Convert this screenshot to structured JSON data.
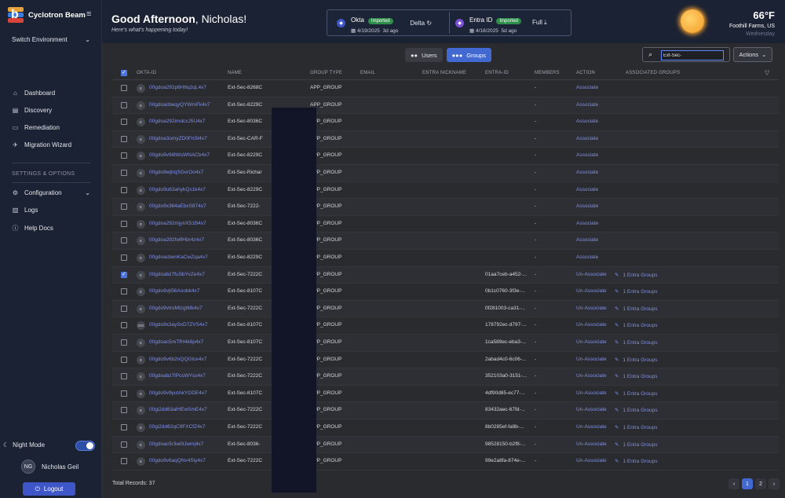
{
  "app": {
    "name": "Cyclotron Beam",
    "collapse_icon": "≡"
  },
  "sidebar": {
    "switch_env": "Switch Environment",
    "nav": [
      {
        "label": "Dashboard",
        "icon": "home-icon",
        "glyph": "⌂"
      },
      {
        "label": "Discovery",
        "icon": "document-icon",
        "glyph": "▤"
      },
      {
        "label": "Remediation",
        "icon": "monitor-icon",
        "glyph": "▭"
      },
      {
        "label": "Migration Wizard",
        "icon": "rocket-icon",
        "glyph": "✈"
      }
    ],
    "section": "SETTINGS & OPTIONS",
    "settings": [
      {
        "label": "Configuration",
        "icon": "gear-icon",
        "glyph": "⚙"
      },
      {
        "label": "Logs",
        "icon": "logs-icon",
        "glyph": "▥"
      },
      {
        "label": "Help Docs",
        "icon": "help-icon",
        "glyph": "ⓘ"
      }
    ],
    "night_mode": "Night Mode",
    "user": {
      "initials": "NG",
      "name": "Nicholas Geil"
    },
    "logout": "Logout"
  },
  "header": {
    "greeting_bold": "Good Afternoon",
    "greeting_rest": ", Nicholas!",
    "subtitle": "Here's what's happening today!",
    "sync": [
      {
        "name": "Okta",
        "badge": "Imported",
        "date": "4/19/2025",
        "ago": "3d ago",
        "mode": "Delta",
        "mode_icon": "↻"
      },
      {
        "name": "Entra ID",
        "badge": "Imported",
        "date": "4/18/2025",
        "ago": "5d ago",
        "mode": "Full",
        "mode_icon": "⤓"
      }
    ],
    "weather": {
      "temp": "66°F",
      "location": "Foothill Farms, US",
      "day": "Wednesday"
    }
  },
  "toolbar": {
    "tabs": [
      {
        "label": "Users",
        "icon": "users-icon",
        "glyph": "👥"
      },
      {
        "label": "Groups",
        "icon": "groups-icon",
        "glyph": "👥"
      }
    ],
    "search_value": "Ext-Sec-",
    "actions": "Actions"
  },
  "table": {
    "columns": [
      "OKTA-ID",
      "NAME",
      "GROUP TYPE",
      "EMAIL",
      "ENTRA NICKNAME",
      "ENTRA-ID",
      "MEMBERS",
      "ACTION",
      "ASSOCIATED GROUPS"
    ],
    "rows": [
      {
        "checked": false,
        "type": "E",
        "okta_id": "00gdoa292p6H6q2qL4x7",
        "name": "Ext-Sec-8268C",
        "group_type": "APP_GROUP",
        "entra_id": "",
        "members": "-",
        "action": "Associate",
        "assoc": ""
      },
      {
        "checked": false,
        "type": "E",
        "okta_id": "00gdoacbeqyQYWmFk4x7",
        "name": "Ext-Sec-8229C",
        "group_type": "APP_GROUP",
        "entra_id": "",
        "members": "-",
        "action": "Associate",
        "assoc": ""
      },
      {
        "checked": false,
        "type": "E",
        "okta_id": "00gdoa292imdcxJ5U4x7",
        "name": "Ext-Sec-8036C",
        "group_type": "APP_GROUP",
        "entra_id": "",
        "members": "-",
        "action": "Associate",
        "assoc": ""
      },
      {
        "checked": false,
        "type": "E",
        "okta_id": "00gdoa3omyZD0FnSl4x7",
        "name": "Ext-Sec-CAR-F",
        "group_type": "APP_GROUP",
        "entra_id": "",
        "members": "-",
        "action": "Associate",
        "assoc": ""
      },
      {
        "checked": false,
        "type": "E",
        "okta_id": "00gdo9v9i8WsWNACb4x7",
        "name": "Ext-Sec-8229C",
        "group_type": "APP_GROUP",
        "entra_id": "",
        "members": "-",
        "action": "Associate",
        "assoc": ""
      },
      {
        "checked": false,
        "type": "E",
        "okta_id": "00gdo9wjtrqSGvrOo4x7",
        "name": "Ext-Sec-Richar",
        "group_type": "APP_GROUP",
        "entra_id": "",
        "members": "-",
        "action": "Associate",
        "assoc": ""
      },
      {
        "checked": false,
        "type": "E",
        "okta_id": "00gdo9u63ahykQs1k4x7",
        "name": "Ext-Sec-8229C",
        "group_type": "APP_GROUP",
        "entra_id": "",
        "members": "-",
        "action": "Associate",
        "assoc": ""
      },
      {
        "checked": false,
        "type": "E",
        "okta_id": "00gdo9x364aEbxS874x7",
        "name": "Ext-Sec-7222-",
        "group_type": "APP_GROUP",
        "entra_id": "",
        "members": "-",
        "action": "Associate",
        "assoc": ""
      },
      {
        "checked": false,
        "type": "E",
        "okta_id": "00gdoa292mjynX51B4x7",
        "name": "Ext-Sec-8036C",
        "group_type": "APP_GROUP",
        "entra_id": "",
        "members": "-",
        "action": "Associate",
        "assoc": ""
      },
      {
        "checked": false,
        "type": "E",
        "okta_id": "00gdoa292fwflHbr4z4x7",
        "name": "Ext-Sec-8036C",
        "group_type": "APP_GROUP",
        "entra_id": "",
        "members": "-",
        "action": "Associate",
        "assoc": ""
      },
      {
        "checked": false,
        "type": "E",
        "okta_id": "00gdoacbenKaCwZqa4x7",
        "name": "Ext-Sec-8229C",
        "group_type": "APP_GROUP",
        "entra_id": "",
        "members": "-",
        "action": "Associate",
        "assoc": ""
      },
      {
        "checked": true,
        "type": "E",
        "okta_id": "00gdoabz7fuSbYvZe4x7",
        "name": "Ext-Sec-7222C",
        "group_type": "APP_GROUP",
        "entra_id": "01aa7ceb-a452-...",
        "members": "-",
        "action": "Un-Associate",
        "assoc": "1 Entra Groups"
      },
      {
        "checked": false,
        "type": "E",
        "okta_id": "00gdo9vjt56Aoobk4x7",
        "name": "Ext-Sec-8107C",
        "group_type": "APP_GROUP",
        "entra_id": "0b1c0760-3f3e-...",
        "members": "-",
        "action": "Un-Associate",
        "assoc": "1 Entra Groups"
      },
      {
        "checked": false,
        "type": "E",
        "okta_id": "00gdo9vtroMtzgtMk4x7",
        "name": "Ext-Sec-7222C",
        "group_type": "APP_GROUP",
        "entra_id": "0f281003-ca31-...",
        "members": "-",
        "action": "Un-Associate",
        "assoc": "1 Entra Groups"
      },
      {
        "checked": false,
        "type": "EM",
        "okta_id": "00gdo9x3aySxD7ZVS4x7",
        "name": "Ext-Sec-8107C",
        "group_type": "APP_GROUP",
        "entra_id": "178792ec-d797-...",
        "members": "-",
        "action": "Un-Associate",
        "assoc": "1 Entra Groups"
      },
      {
        "checked": false,
        "type": "E",
        "okta_id": "00gdoac5reTfH4k6p4x7",
        "name": "Ext-Sec-8107C",
        "group_type": "APP_GROUP",
        "entra_id": "1ca589ec-eba3-...",
        "members": "-",
        "action": "Un-Associate",
        "assoc": "1 Entra Groups"
      },
      {
        "checked": false,
        "type": "E",
        "okta_id": "00gdo9v6b2nQQGlce4x7",
        "name": "Ext-Sec-7222C",
        "group_type": "APP_GROUP",
        "entra_id": "2abad4c0-6c06-...",
        "members": "-",
        "action": "Un-Associate",
        "assoc": "1 Entra Groups"
      },
      {
        "checked": false,
        "type": "E",
        "okta_id": "00gdoabz7lPcsWYss4x7",
        "name": "Ext-Sec-7222C",
        "group_type": "APP_GROUP",
        "entra_id": "352103a0-3151-...",
        "members": "-",
        "action": "Un-Associate",
        "assoc": "1 Entra Groups"
      },
      {
        "checked": false,
        "type": "E",
        "okta_id": "00gdo9v9yutAkYGDE4x7",
        "name": "Ext-Sec-8107C",
        "group_type": "APP_GROUP",
        "entra_id": "4df90d85-ec77-...",
        "members": "-",
        "action": "Un-Associate",
        "assoc": "1 Entra Groups"
      },
      {
        "checked": false,
        "type": "E",
        "okta_id": "00gi2dd63alHEwSmE4x7",
        "name": "Ext-Sec-7222C",
        "group_type": "APP_GROUP",
        "entra_id": "83432aec-67fd-...",
        "members": "-",
        "action": "Un-Associate",
        "assoc": "1 Entra Groups"
      },
      {
        "checked": false,
        "type": "E",
        "okta_id": "00gi2dd62qC9FXCfZ4x7",
        "name": "Ext-Sec-7222C",
        "group_type": "APP_GROUP",
        "entra_id": "8b0285ef-fa9b-...",
        "members": "-",
        "action": "Un-Associate",
        "assoc": "1 Entra Groups"
      },
      {
        "checked": false,
        "type": "E",
        "okta_id": "00gdoac5r3wi9Jwmj4x7",
        "name": "Ext-Sec-8036-",
        "group_type": "APP_GROUP",
        "entra_id": "98528150-b2f8-...",
        "members": "-",
        "action": "Un-Associate",
        "assoc": "1 Entra Groups"
      },
      {
        "checked": false,
        "type": "E",
        "okta_id": "00gdo9v6aqQNv4Siy4x7",
        "name": "Ext-Sec-7222C",
        "group_type": "APP_GROUP",
        "entra_id": "99e2a8fa-874e-...",
        "members": "-",
        "action": "Un-Associate",
        "assoc": "1 Entra Groups"
      }
    ]
  },
  "footer": {
    "total": "Total Records: 37",
    "pages": [
      "‹",
      "1",
      "2",
      "›"
    ],
    "current_page": "1"
  },
  "colors": {
    "accent": "#4269d2",
    "link": "#7f8fe8",
    "sidebar": "#1b2233",
    "imported": "#2f8d4a"
  }
}
